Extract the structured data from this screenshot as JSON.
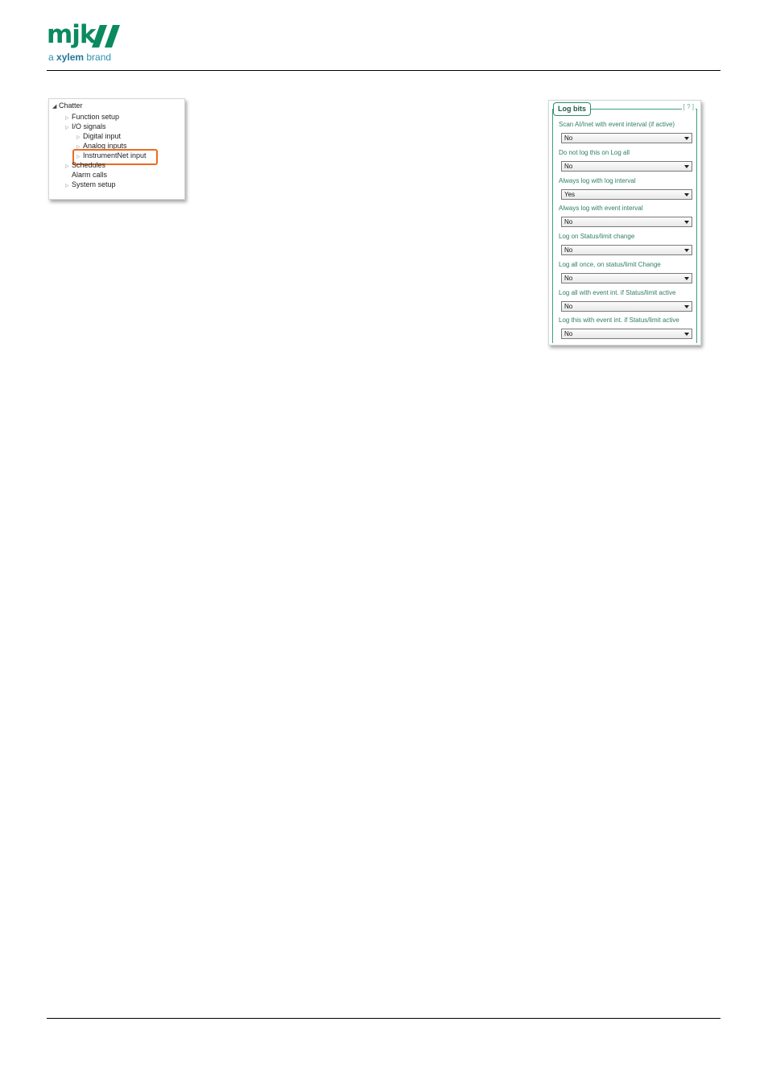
{
  "header": {
    "logo_word": "mjk",
    "logo_sub_prefix": "a ",
    "logo_sub_brand": "xylem",
    "logo_sub_suffix": " brand",
    "brand_color": "#0b8a5f"
  },
  "tree": {
    "root": "Chatter",
    "items": [
      {
        "label": "Function setup"
      },
      {
        "label": "I/O signals"
      },
      {
        "label": "Digital input"
      },
      {
        "label": "Analog inputs"
      },
      {
        "label": "InstrumentNet input"
      },
      {
        "label": "Schedules"
      },
      {
        "label": "Alarm calls"
      },
      {
        "label": "System setup"
      }
    ],
    "highlight_color": "#ee6a1f"
  },
  "log_bits": {
    "title": "Log bits",
    "help": "[ ? ]",
    "fields": [
      {
        "label": "Scan AI/Inet with event interval (if active)",
        "value": "No"
      },
      {
        "label": "Do not log this on Log all",
        "value": "No"
      },
      {
        "label": "Always log with log interval",
        "value": "Yes"
      },
      {
        "label": "Always log with event interval",
        "value": "No"
      },
      {
        "label": "Log on Status/limit change",
        "value": "No"
      },
      {
        "label": "Log all once, on status/limit Change",
        "value": "No"
      },
      {
        "label": "Log all with event int. if Status/limit active",
        "value": "No"
      },
      {
        "label": "Log this with event int. if Status/limit active",
        "value": "No"
      }
    ]
  }
}
